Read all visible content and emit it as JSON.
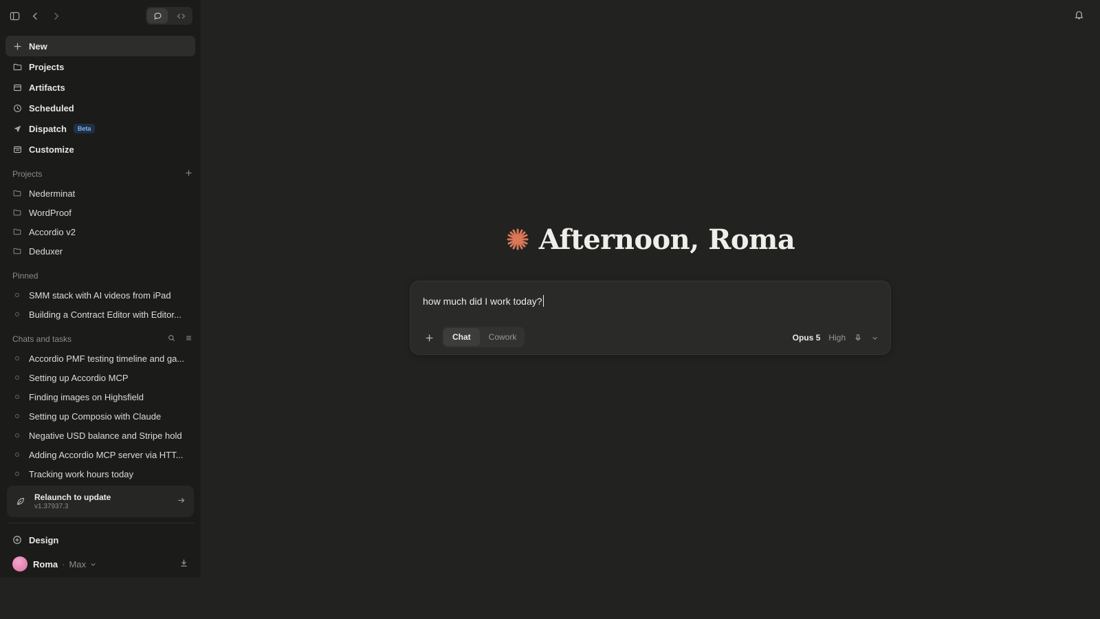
{
  "sidebar": {
    "nav": [
      {
        "label": "New",
        "icon": "plus-icon"
      },
      {
        "label": "Projects",
        "icon": "folder-icon"
      },
      {
        "label": "Artifacts",
        "icon": "artifacts-icon"
      },
      {
        "label": "Scheduled",
        "icon": "clock-icon"
      },
      {
        "label": "Dispatch",
        "icon": "send-icon",
        "badge": "Beta"
      },
      {
        "label": "Customize",
        "icon": "customize-icon"
      }
    ],
    "projects_heading": "Projects",
    "projects": [
      "Nederminat",
      "WordProof",
      "Accordio v2",
      "Deduxer"
    ],
    "pinned_heading": "Pinned",
    "pinned": [
      "SMM stack with AI videos from iPad",
      "Building a Contract Editor with Editor..."
    ],
    "chats_heading": "Chats and tasks",
    "chats": [
      "Accordio PMF testing timeline and ga...",
      "Setting up Accordio MCP",
      "Finding images on Highsfield",
      "Setting up Composio with Claude",
      "Negative USD balance and Stripe hold",
      "Adding Accordio MCP server via HTT...",
      "Tracking work hours today"
    ],
    "update": {
      "title": "Relaunch to update",
      "version": "v1.37937.3"
    },
    "design_label": "Design",
    "user": {
      "name": "Roma",
      "separator": "·",
      "plan": "Max"
    }
  },
  "main": {
    "greeting": "Afternoon, Roma",
    "composer": {
      "value": "how much did I work today?",
      "modes": [
        "Chat",
        "Cowork"
      ],
      "active_mode": "Chat",
      "model": "Opus 5",
      "effort": "High"
    }
  },
  "colors": {
    "accent_star": "#d97757",
    "sidebar_bg": "#1b1b1a",
    "main_bg": "#222221",
    "beta_badge": "#7fb0e8"
  }
}
